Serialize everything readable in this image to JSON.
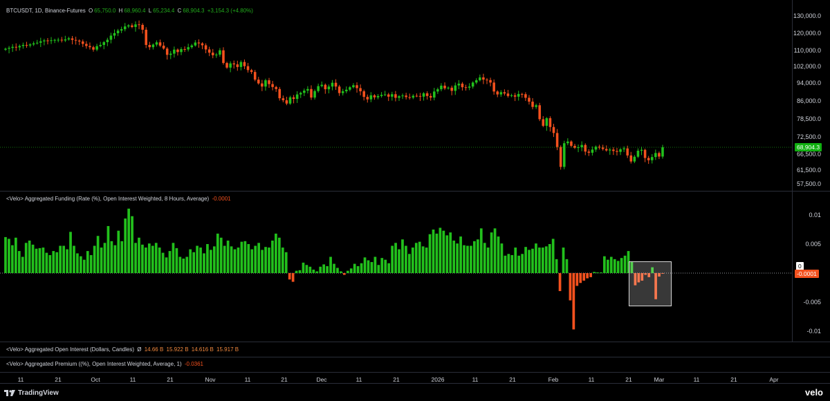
{
  "chart_title": {
    "symbol": "BTCUSDT, 1D, Binance-Futures",
    "o_label": "O",
    "o_value": "65,750.0",
    "h_label": "H",
    "h_value": "68,960.4",
    "l_label": "L",
    "l_value": "65,234.4",
    "c_label": "C",
    "c_value": "68,904.3",
    "change": "+3,154.3 (+4.80%)"
  },
  "price_axis": {
    "ticks": [
      "130,000.0",
      "120,000.0",
      "110,000.0",
      "102,000.0",
      "94,000.0",
      "86,000.0",
      "78,500.0",
      "72,500.0",
      "66,500.0",
      "61,500.0",
      "57,500.0"
    ],
    "last_price": "68,904.3"
  },
  "funding": {
    "legend": "<Velo> Aggregated Funding (Rate (%), Open Interest Weighted, 8 Hours, Average)",
    "value": "-0.0001",
    "ticks": [
      "0.01",
      "0.005",
      "0",
      "-0.005",
      "-0.01"
    ],
    "zero_tag": "0",
    "last_tag": "-0.0001"
  },
  "open_interest": {
    "legend": "<Velo> Aggregated Open Interest (Dollars, Candles)",
    "symbol": "Ø",
    "values": [
      "14.66 B",
      "15.922 B",
      "14.616 B",
      "15.917 B"
    ]
  },
  "premium": {
    "legend": "<Velo> Aggregated Premium ((%), Open Interest Weighted, Average, 1)",
    "value": "-0.0361"
  },
  "time_axis": {
    "labels": [
      "11",
      "21",
      "Oct",
      "11",
      "21",
      "Nov",
      "11",
      "21",
      "Dec",
      "11",
      "21",
      "2026",
      "11",
      "21",
      "Feb",
      "11",
      "21",
      "Mar",
      "11",
      "21",
      "Apr"
    ]
  },
  "branding": {
    "tradingview": "TradingView",
    "velo": "velo"
  },
  "colors": {
    "up": "#22c01c",
    "down": "#f4511e",
    "background": "#000000"
  },
  "chart_data": [
    {
      "type": "candlestick",
      "title": "BTCUSDT, 1D, Binance-Futures",
      "ylim": [
        55000,
        132000
      ],
      "x_start": "Sep 2",
      "x_end": "Mar 1",
      "close": [
        111000,
        111500,
        112100,
        111800,
        112600,
        113200,
        112900,
        113500,
        114100,
        114500,
        115300,
        115800,
        115600,
        115900,
        116100,
        116200,
        115800,
        116400,
        117000,
        116100,
        115700,
        115200,
        113800,
        112600,
        111900,
        110500,
        112500,
        113200,
        114800,
        116200,
        118600,
        120000,
        121500,
        122300,
        123900,
        124500,
        123600,
        125100,
        124800,
        122000,
        113200,
        111900,
        113400,
        114700,
        112800,
        111100,
        107800,
        108400,
        110500,
        109200,
        110800,
        110600,
        111900,
        112900,
        114600,
        114100,
        113000,
        110600,
        108900,
        107600,
        107900,
        110100,
        103700,
        101400,
        103500,
        103000,
        101700,
        104200,
        102100,
        100200,
        99300,
        95600,
        93800,
        92400,
        95300,
        93500,
        92200,
        91300,
        87200,
        86300,
        84900,
        87600,
        86900,
        88900,
        89600,
        90600,
        91300,
        87500,
        90400,
        92600,
        93200,
        91200,
        92400,
        94100,
        92400,
        89500,
        90300,
        91000,
        92100,
        93000,
        91700,
        90300,
        87800,
        86700,
        88500,
        87600,
        88200,
        88700,
        88900,
        87900,
        89000,
        87400,
        88100,
        88400,
        87700,
        87500,
        88300,
        88200,
        87900,
        89400,
        88200,
        87500,
        90200,
        91200,
        92800,
        91600,
        91900,
        90500,
        92900,
        93700,
        92100,
        91900,
        92400,
        94200,
        95300,
        96700,
        95600,
        95400,
        94200,
        90200,
        88900,
        89900,
        89300,
        88200,
        88500,
        87900,
        89100,
        89000,
        87400,
        85700,
        83500,
        84200,
        78400,
        76200,
        78800,
        75800,
        73800,
        69000,
        62500,
        70300,
        70900,
        69400,
        68700,
        68900,
        69700,
        67400,
        67000,
        68100,
        69100,
        68800,
        68300,
        67800,
        68100,
        67600,
        67300,
        68200,
        68500,
        66100,
        64200,
        65700,
        67700,
        68000,
        65300,
        64600,
        65600,
        66900,
        65750,
        68904
      ]
    },
    {
      "type": "bar",
      "title": "<Velo> Aggregated Funding (Rate (%), Open Interest Weighted, 8 Hours, Average)",
      "ylim": [
        -0.0115,
        0.0125
      ],
      "values": [
        0.0062,
        0.0059,
        0.0048,
        0.0061,
        0.0038,
        0.0028,
        0.0052,
        0.0056,
        0.0049,
        0.0042,
        0.0043,
        0.0044,
        0.0035,
        0.0031,
        0.0038,
        0.0036,
        0.0047,
        0.0047,
        0.0041,
        0.0071,
        0.0047,
        0.0034,
        0.0029,
        0.0023,
        0.0038,
        0.0031,
        0.0047,
        0.0064,
        0.0044,
        0.0052,
        0.0081,
        0.0055,
        0.0048,
        0.0073,
        0.0055,
        0.0094,
        0.0111,
        0.0098,
        0.0052,
        0.0061,
        0.0049,
        0.0044,
        0.0051,
        0.0047,
        0.0052,
        0.0044,
        0.0035,
        0.0027,
        0.0038,
        0.0052,
        0.0043,
        0.0028,
        0.0025,
        0.0028,
        0.0041,
        0.0036,
        0.0047,
        0.0044,
        0.0034,
        0.005,
        0.004,
        0.0046,
        0.0068,
        0.0061,
        0.0047,
        0.0056,
        0.0046,
        0.0041,
        0.0044,
        0.0054,
        0.0055,
        0.005,
        0.0041,
        0.0047,
        0.0052,
        0.004,
        0.0045,
        0.0044,
        0.0056,
        0.0068,
        0.0061,
        0.0044,
        0.0036,
        -0.0011,
        -0.0015,
        0.0004,
        0.0005,
        0.0018,
        0.0014,
        0.0011,
        0.0006,
        0.0003,
        0.0011,
        0.0015,
        0.0012,
        0.0028,
        0.0016,
        0.0009,
        0.0003,
        -0.0003,
        0.0004,
        0.0008,
        0.0016,
        0.0012,
        0.0017,
        0.0027,
        0.0022,
        0.0019,
        0.0028,
        0.0014,
        0.0026,
        0.0023,
        0.0017,
        0.0047,
        0.0052,
        0.0041,
        0.0058,
        0.0047,
        0.0033,
        0.0044,
        0.0052,
        0.0054,
        0.0046,
        0.0044,
        0.0067,
        0.0075,
        0.0068,
        0.0078,
        0.0073,
        0.0065,
        0.007,
        0.0056,
        0.0051,
        0.0063,
        0.0048,
        0.0047,
        0.0047,
        0.0055,
        0.0058,
        0.0077,
        0.0052,
        0.0044,
        0.007,
        0.0077,
        0.0063,
        0.0051,
        0.003,
        0.0033,
        0.0031,
        0.0044,
        0.003,
        0.0033,
        0.0045,
        0.004,
        0.0042,
        0.0051,
        0.0044,
        0.0044,
        0.0046,
        0.005,
        0.0059,
        0.0024,
        -0.0031,
        0.0044,
        0.0024,
        -0.0047,
        -0.0097,
        -0.0022,
        -0.0017,
        -0.0013,
        -0.0009,
        -0.0007,
        0.0002,
        0.0001,
        0.0001,
        0.0029,
        0.0023,
        0.0028,
        0.0024,
        0.0021,
        0.0026,
        0.003,
        0.0038,
        0.0019,
        -0.0021,
        -0.0016,
        -0.0013,
        -0.0003,
        -0.0007,
        0.001,
        -0.0045,
        -0.0006,
        -0.0001
      ]
    }
  ]
}
